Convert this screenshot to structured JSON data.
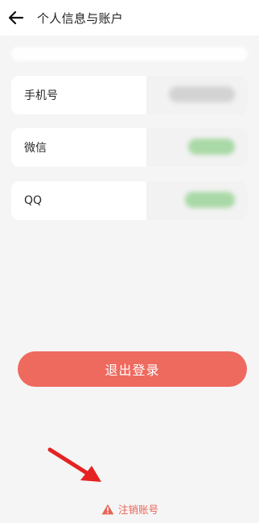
{
  "header": {
    "title": "个人信息与账户",
    "back_icon": "arrow-left-icon"
  },
  "rows": [
    {
      "label": "手机号",
      "value_hidden": true
    },
    {
      "label": "微信",
      "value_hidden": true
    },
    {
      "label": "QQ",
      "value_hidden": true
    }
  ],
  "logout": {
    "label": "退出登录",
    "color": "#ee6a5e"
  },
  "cancel_account": {
    "label": "注销账号",
    "icon": "warning-icon",
    "color": "#ea6356"
  },
  "annotation": {
    "icon": "red-arrow-icon",
    "color": "#e52222"
  }
}
